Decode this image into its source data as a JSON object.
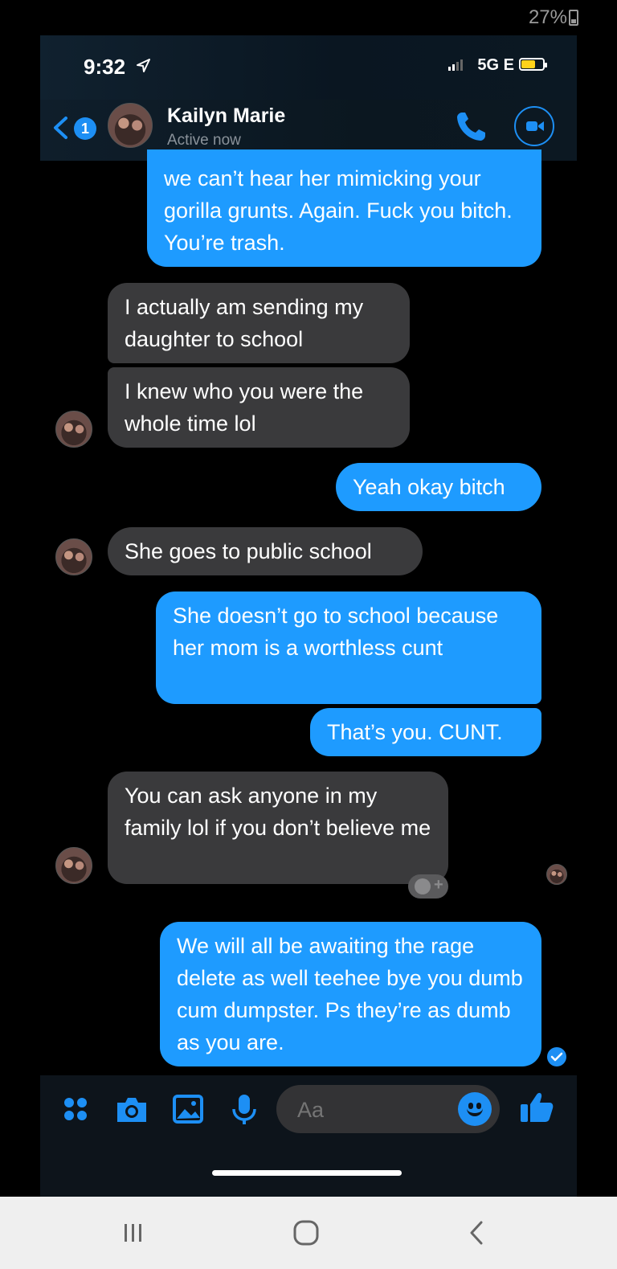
{
  "device_status": {
    "battery": "27%"
  },
  "messenger": {
    "status_bar": {
      "time": "9:32",
      "network": "5G E"
    },
    "header": {
      "unread_count": "1",
      "contact_name": "Kailyn Marie",
      "contact_status": "Active now"
    },
    "messages": [
      {
        "direction": "out",
        "text": "we can’t hear her mimicking your gorilla grunts. Again. Fuck you bitch. You’re trash."
      },
      {
        "direction": "in",
        "text": "I actually am sending my daughter to school"
      },
      {
        "direction": "in",
        "text": "I knew who you were the whole time lol"
      },
      {
        "direction": "out",
        "text": "Yeah okay bitch"
      },
      {
        "direction": "in",
        "text": "She goes to public school"
      },
      {
        "direction": "out",
        "text": "She doesn’t go to school because her mom is a worthless cunt"
      },
      {
        "direction": "out",
        "text": "That’s you. CUNT."
      },
      {
        "direction": "in",
        "text": "You can ask anyone in my family lol if you don’t believe me"
      },
      {
        "direction": "out",
        "text": "We will all be awaiting the rage delete as well teehee bye you dumb cum dumpster. Ps they’re as dumb as you are."
      }
    ],
    "composer": {
      "placeholder": "Aa"
    }
  },
  "colors": {
    "outgoing_bubble": "#1e9bff",
    "incoming_bubble": "#3a3a3c",
    "accent": "#1d8ff4",
    "background": "#000000"
  },
  "icons": [
    "back-chevron-icon",
    "phone-icon",
    "video-camera-icon",
    "apps-grid-icon",
    "camera-icon",
    "gallery-icon",
    "microphone-icon",
    "emoji-icon",
    "thumbs-up-icon",
    "recents-icon",
    "home-icon",
    "back-icon"
  ]
}
